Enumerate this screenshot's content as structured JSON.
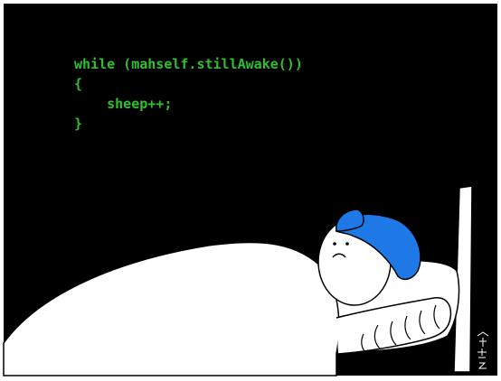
{
  "code": {
    "lines": [
      "while (mahself.stillAwake())",
      "{",
      "    sheep++;",
      "}"
    ],
    "color": "#2fbf2f"
  },
  "colors": {
    "background": "#000000",
    "frame": "#ffffff",
    "cap": "#1e78e6",
    "blanket": "#ffffff",
    "line": "#000000"
  }
}
